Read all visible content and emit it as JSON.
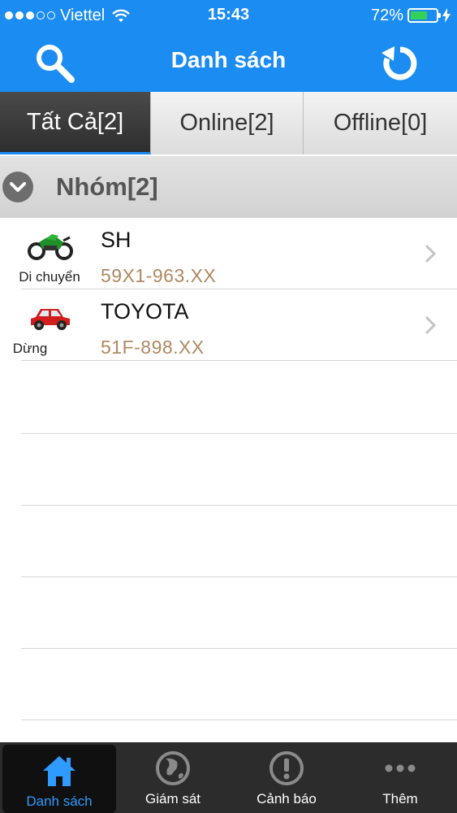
{
  "status_bar": {
    "carrier": "Viettel",
    "time": "15:43",
    "battery": "72%",
    "battery_level": 0.72,
    "signal_bars_filled": 3,
    "signal_bars_total": 5
  },
  "nav": {
    "title": "Danh sách",
    "search_icon": "search-icon",
    "refresh_icon": "refresh-icon"
  },
  "tabs": [
    {
      "label": "Tất Cả[2]",
      "active": true
    },
    {
      "label": "Online[2]",
      "active": false
    },
    {
      "label": "Offline[0]",
      "active": false
    }
  ],
  "group": {
    "label": "Nhóm[2]",
    "expanded": true
  },
  "vehicles": [
    {
      "name": "SH",
      "plate": "59X1-963.XX",
      "status": "Di chuyển",
      "icon": "motorbike-icon"
    },
    {
      "name": "TOYOTA",
      "plate": "51F-898.XX",
      "status": "Dừng",
      "icon": "car-icon"
    }
  ],
  "tab_bar": [
    {
      "label": "Danh sách",
      "icon": "home-icon",
      "active": true
    },
    {
      "label": "Giám sát",
      "icon": "globe-icon",
      "active": false
    },
    {
      "label": "Cảnh báo",
      "icon": "alert-icon",
      "active": false
    },
    {
      "label": "Thêm",
      "icon": "more-icon",
      "active": false
    }
  ],
  "colors": {
    "primary": "#1a8cf2",
    "plate_text": "#b08860",
    "active_tab_label": "#2f9bff",
    "tab_bar_bg": "#2c2c2c"
  }
}
